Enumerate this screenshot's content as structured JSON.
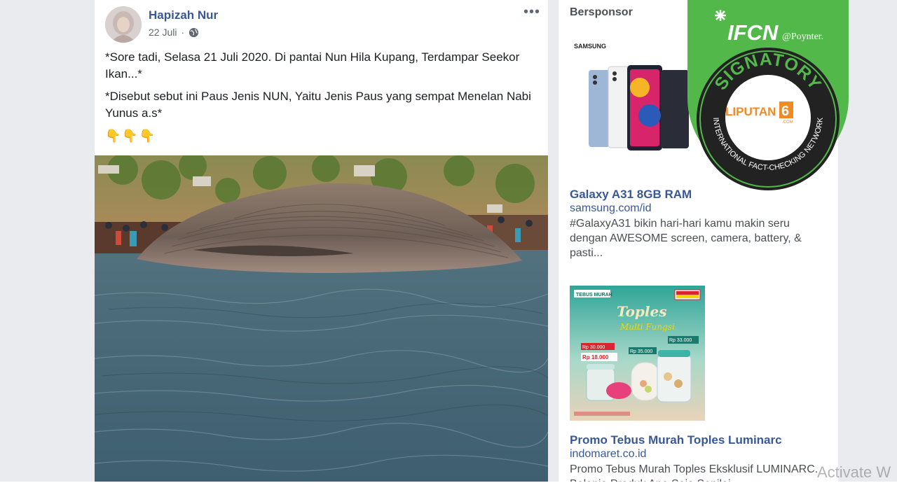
{
  "post": {
    "author": "Hapizah Nur",
    "date": "22 Juli",
    "text_line1": "*Sore tadi, Selasa 21 Juli 2020. Di pantai Nun Hila Kupang, Terdampar Seekor Ikan...*",
    "text_line2": "*Disebut sebut ini Paus Jenis NUN, Yaitu Jenis Paus yang sempat Menelan Nabi Yunus a.s*",
    "emojis": "👇👇👇",
    "more_label": "•••",
    "privacy_icon": "globe-icon"
  },
  "sponsored": {
    "title": "Bersponsor",
    "ads": [
      {
        "brand_logo": "SAMSUNG",
        "headline": "Galaxy A31 8GB RAM",
        "domain": "samsung.com/id",
        "body": "#GalaxyA31 bikin hari-hari kamu makin seru dengan AWESOME screen, camera, battery, & pasti..."
      },
      {
        "headline": "Promo Tebus Murah Toples Luminarc",
        "domain": "indomaret.co.id",
        "body": "Promo Tebus Murah Toples Eksklusif LUMINARC. Belanja Produk Apa Saja Senilai...",
        "image_banner": "TEBUS MURAH",
        "image_title": "Toples",
        "image_subtitle": "Multi Fungsi",
        "price1": "Rp 30.000",
        "price2": "Rp 18.000",
        "price3": "Rp 35.000",
        "price4": "Rp 33.000",
        "brand_colors": {
          "teal": "#3fb3a8",
          "yellow": "#f5d400",
          "red": "#d7262e"
        }
      }
    ]
  },
  "ifcn": {
    "brand": "IFCN",
    "partner": "@Poynter.",
    "ring_top": "SIGNATORY",
    "ring_bottom": "INTERNATIONAL FACT-CHECKING NETWORK",
    "center_brand": "LIPUTAN",
    "center_number": "6",
    "center_domain": ".COM",
    "colors": {
      "green": "#53b84a",
      "dark": "#222222",
      "orange": "#f08a24"
    }
  },
  "watermark": "Activate W",
  "colors": {
    "link": "#385898",
    "page_bg": "#e9ebee"
  }
}
